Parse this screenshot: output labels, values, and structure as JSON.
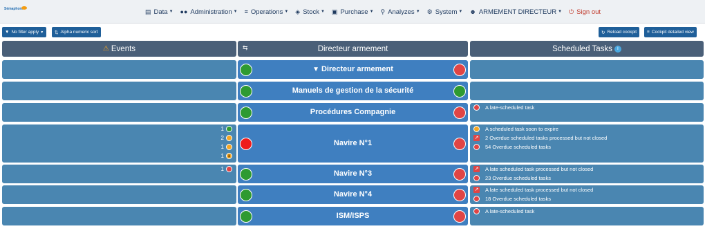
{
  "app": {
    "logo_text": "Sémaphore"
  },
  "menu": {
    "data": "Data",
    "administration": "Administration",
    "operations": "Operations",
    "stock": "Stock",
    "purchase": "Purchase",
    "analyzes": "Analyzes",
    "system": "System",
    "user": "ARMEMENT DIRECTEUR",
    "signout": "Sign out"
  },
  "toolbar": {
    "filter": "No filter apply",
    "sort": "Alpha numeric sort",
    "reload": "Reload cockpit",
    "detailed": "Cockpit detailed view"
  },
  "headers": {
    "events": "Events",
    "middle": "Directeur armement",
    "tasks": "Scheduled Tasks",
    "tasks_info": "i"
  },
  "rows": [
    {
      "label": "Directeur armement",
      "left_status": "green",
      "right_status": "red",
      "events": [],
      "tasks": []
    },
    {
      "label": "Manuels de gestion de la sécurité",
      "left_status": "green",
      "right_status": "green",
      "events": [],
      "tasks": []
    },
    {
      "label": "Procédures Compagnie",
      "left_status": "green",
      "right_status": "red",
      "events": [],
      "tasks": [
        {
          "icon": "red-dot",
          "text": "A late-scheduled task"
        }
      ]
    },
    {
      "label": "Navire N°1",
      "left_status": "red",
      "right_status": "red",
      "events": [
        {
          "count": "1",
          "kind": "green"
        },
        {
          "count": "2",
          "kind": "orange"
        },
        {
          "count": "1",
          "kind": "orange"
        },
        {
          "count": "1",
          "kind": "hourglass"
        }
      ],
      "tasks": [
        {
          "icon": "orange-dot",
          "text": "A scheduled task soon to expire"
        },
        {
          "icon": "red-pin",
          "text": "2 Overdue scheduled tasks processed but not closed"
        },
        {
          "icon": "red-dot",
          "text": "54 Overdue scheduled tasks"
        }
      ]
    },
    {
      "label": "Navire N°3",
      "left_status": "green",
      "right_status": "red",
      "events": [
        {
          "count": "1",
          "kind": "red"
        }
      ],
      "tasks": [
        {
          "icon": "red-pin",
          "text": "A late scheduled task processed but not closed"
        },
        {
          "icon": "red-dot",
          "text": "23 Overdue scheduled tasks"
        }
      ]
    },
    {
      "label": "Navire N°4",
      "left_status": "green",
      "right_status": "red",
      "events": [],
      "tasks": [
        {
          "icon": "red-pin",
          "text": "A late scheduled task processed but not closed"
        },
        {
          "icon": "red-dot",
          "text": "18 Overdue scheduled tasks"
        }
      ]
    },
    {
      "label": "ISM/ISPS",
      "left_status": "green",
      "right_status": "red",
      "events": [],
      "tasks": [
        {
          "icon": "red-dot",
          "text": "A late-scheduled task"
        }
      ]
    }
  ]
}
